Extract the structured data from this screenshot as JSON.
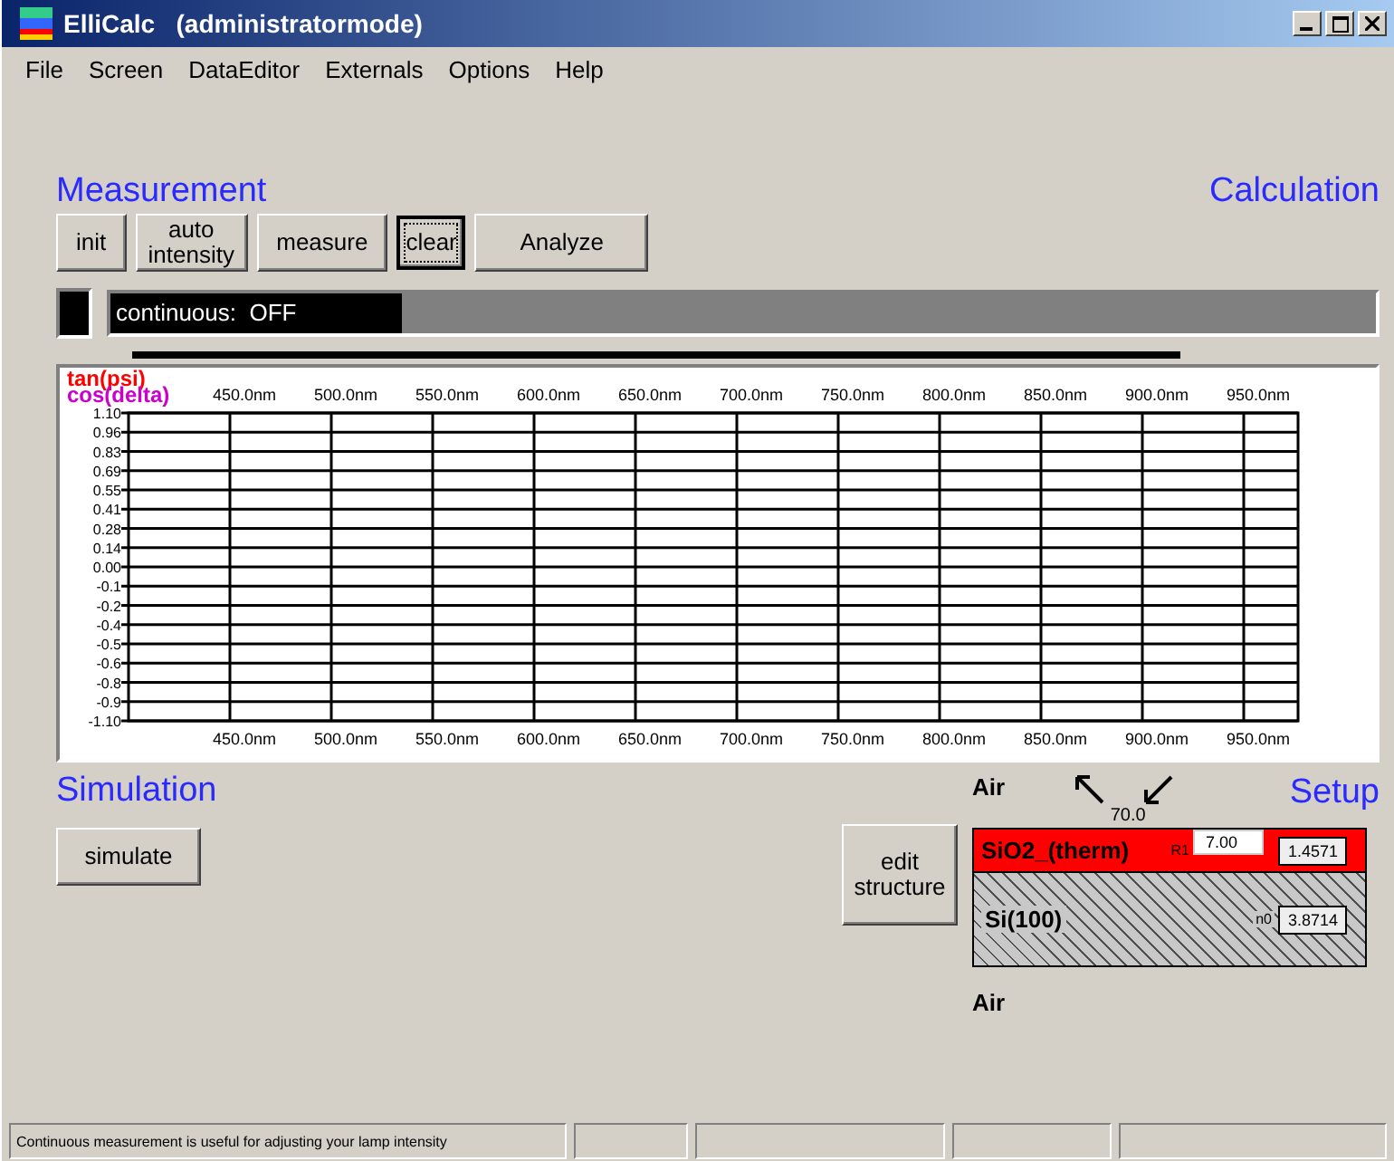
{
  "window": {
    "title": "ElliCalc",
    "mode": "(administratormode)"
  },
  "menu": [
    "File",
    "Screen",
    "DataEditor",
    "Externals",
    "Options",
    "Help"
  ],
  "measurement": {
    "title": "Measurement",
    "buttons": [
      {
        "label": "init",
        "focused": false
      },
      {
        "label": "auto intensity",
        "focused": false
      },
      {
        "label": "measure",
        "focused": false
      }
    ],
    "clear": {
      "label": "clear",
      "focused": true
    }
  },
  "calculation": {
    "title": "Calculation",
    "button": "Analyze"
  },
  "progress": {
    "label": "continuous:  OFF",
    "level": 0.23
  },
  "chart": {
    "legend": [
      {
        "label": "tan(psi)",
        "color": "#ff0000"
      },
      {
        "label": "cos(delta)",
        "color": "#cc00cc"
      }
    ],
    "y_labels": [
      "1.10",
      "0.96",
      "0.83",
      "0.69",
      "0.55",
      "0.41",
      "0.28",
      "0.14",
      "0.00",
      "-0.1",
      "-0.2",
      "-0.4",
      "-0.5",
      "-0.6",
      "-0.8",
      "-0.9",
      "-1.10"
    ],
    "x_labels_top": [
      "450.0nm",
      "500.0nm",
      "550.0nm",
      "600.0nm",
      "650.0nm",
      "700.0nm",
      "750.0nm",
      "800.0nm",
      "850.0nm",
      "900.0nm",
      "950.0nm"
    ],
    "x_labels_bottom": [
      "450.0nm",
      "500.0nm",
      "550.0nm",
      "600.0nm",
      "650.0nm",
      "700.0nm",
      "750.0nm",
      "800.0nm",
      "850.0nm",
      "900.0nm",
      "950.0nm"
    ]
  },
  "simulation": {
    "title": "Simulation",
    "button": "simulate"
  },
  "setup": {
    "title": "Setup",
    "edit_button": "edit structure",
    "ambient_top": "Air",
    "angle": "70.0",
    "ambient_bottom": "Air",
    "layers": [
      {
        "name": "SiO2_(therm)",
        "kind": "film",
        "tag": "R1",
        "thickness": "7.00",
        "index": "1.4571"
      },
      {
        "name": "Si(100)",
        "kind": "substrate",
        "tag": "n0",
        "index": "3.8714"
      }
    ]
  },
  "status_bar": {
    "message": "Continuous measurement is useful for adjusting your lamp intensity"
  }
}
